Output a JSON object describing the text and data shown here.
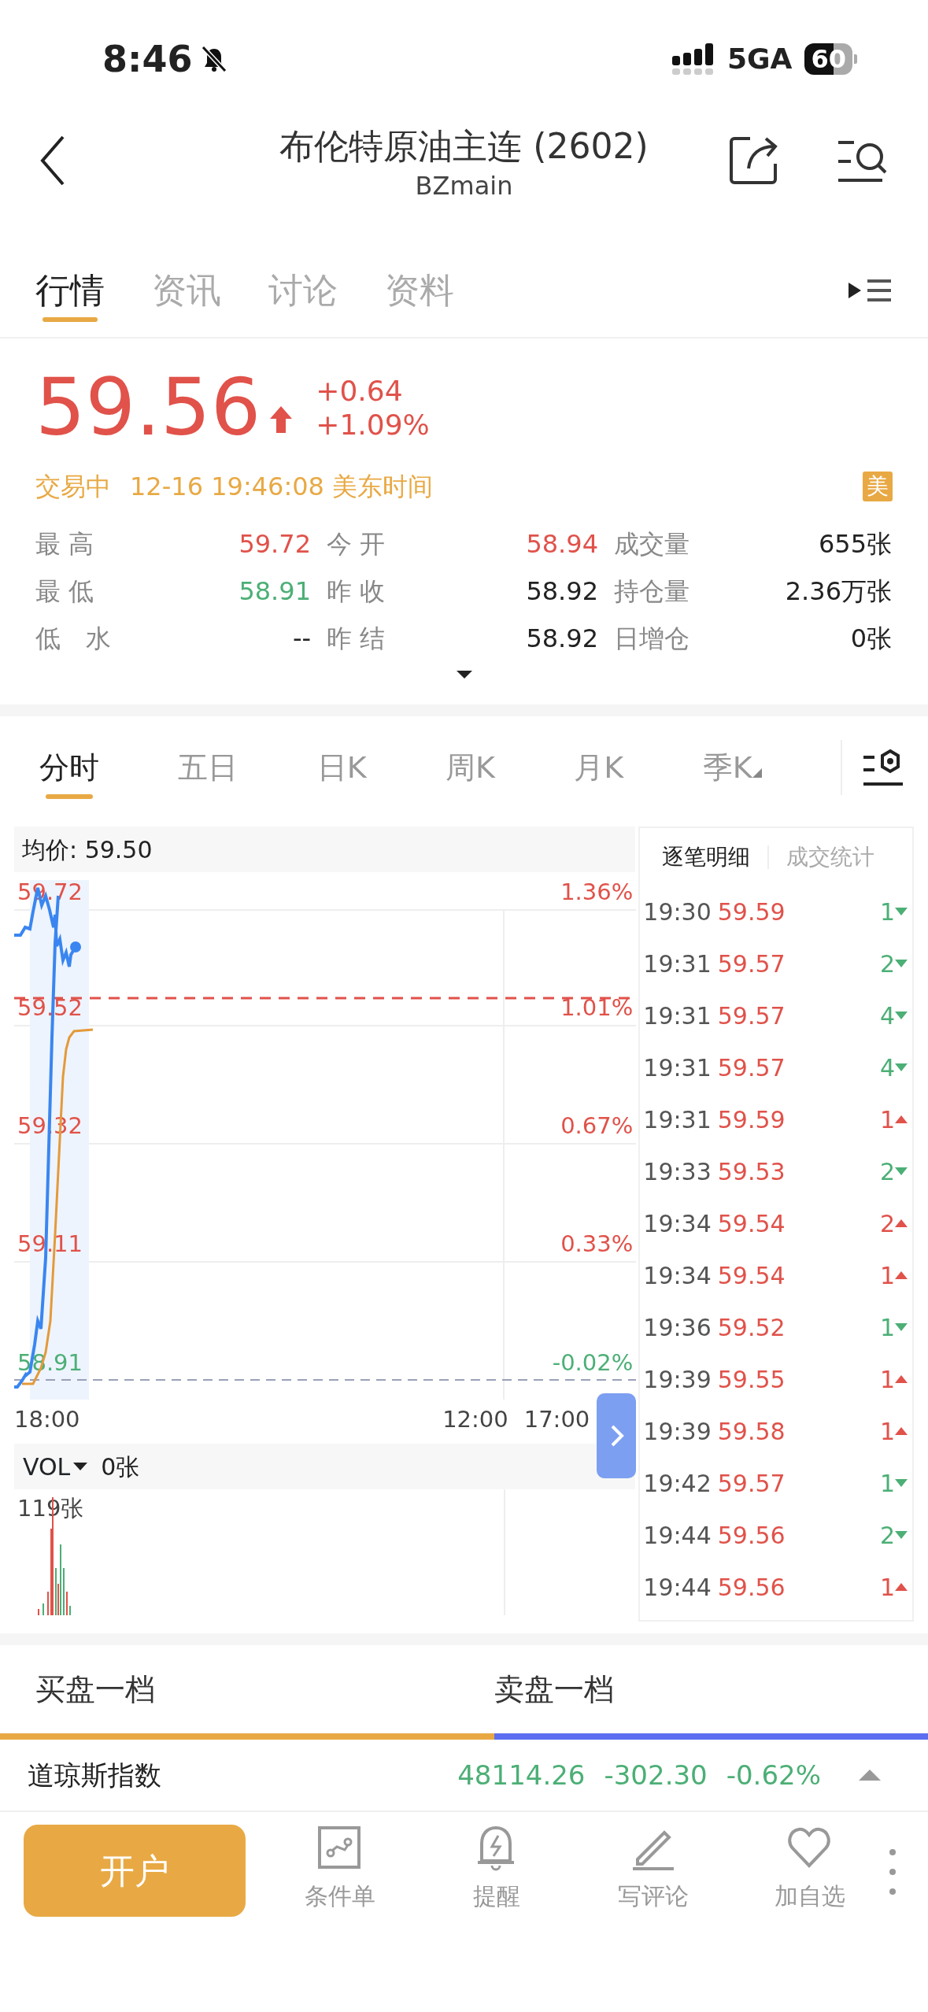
{
  "status_bar": {
    "time": "8:46",
    "network": "5GA",
    "battery": "60"
  },
  "header": {
    "title": "布伦特原油主连 (2602)",
    "subtitle": "BZmain"
  },
  "tabs": [
    {
      "label": "行情",
      "selected": true
    },
    {
      "label": "资讯",
      "selected": false
    },
    {
      "label": "讨论",
      "selected": false
    },
    {
      "label": "资料",
      "selected": false
    }
  ],
  "quote": {
    "price": "59.56",
    "up": true,
    "change": "+0.64",
    "change_pct": "+1.09%",
    "status": "交易中",
    "time": "12-16 19:46:08 美东时间",
    "market_badge": "美"
  },
  "stats": [
    {
      "items": [
        {
          "label": "最 高",
          "value": "59.72",
          "color": "#e0524a"
        },
        {
          "label": "今 开",
          "value": "58.94",
          "color": "#e0524a"
        },
        {
          "label": "成交量",
          "value": "655张",
          "color": "#222222"
        }
      ]
    },
    {
      "items": [
        {
          "label": "最 低",
          "value": "58.91",
          "color": "#4caf76"
        },
        {
          "label": "昨 收",
          "value": "58.92",
          "color": "#222222"
        },
        {
          "label": "持仓量",
          "value": "2.36万张",
          "color": "#222222"
        }
      ]
    },
    {
      "items": [
        {
          "label": "低　水",
          "value": "--",
          "color": "#222222"
        },
        {
          "label": "昨 结",
          "value": "58.92",
          "color": "#222222"
        },
        {
          "label": "日增仓",
          "value": "0张",
          "color": "#222222"
        }
      ]
    }
  ],
  "chart_tabs": [
    {
      "label": "分时",
      "selected": true,
      "dropdown": false
    },
    {
      "label": "五日",
      "selected": false,
      "dropdown": false
    },
    {
      "label": "日K",
      "selected": false,
      "dropdown": false
    },
    {
      "label": "周K",
      "selected": false,
      "dropdown": false
    },
    {
      "label": "月K",
      "selected": false,
      "dropdown": false
    },
    {
      "label": "季K",
      "selected": false,
      "dropdown": true
    }
  ],
  "chart": {
    "average": "均价: 59.50",
    "left_labels": [
      {
        "text": "59.72",
        "color": "#e0524a"
      },
      {
        "text": "59.52",
        "color": "#e0524a"
      },
      {
        "text": "59.32",
        "color": "#e0524a"
      },
      {
        "text": "59.11",
        "color": "#e0524a"
      },
      {
        "text": "58.91",
        "color": "#4caf76"
      }
    ],
    "right_labels": [
      {
        "text": "1.36%",
        "color": "#e0524a"
      },
      {
        "text": "1.01%",
        "color": "#e0524a"
      },
      {
        "text": "0.67%",
        "color": "#e0524a"
      },
      {
        "text": "0.33%",
        "color": "#e0524a"
      },
      {
        "text": "-0.02%",
        "color": "#4caf76"
      }
    ],
    "x_labels": [
      "18:00",
      "12:00",
      "17:00"
    ],
    "volume": {
      "label": "VOL",
      "value": "0张",
      "max": "119张"
    }
  },
  "trades": {
    "tabs": [
      {
        "label": "逐笔明细",
        "selected": true
      },
      {
        "label": "成交统计",
        "selected": false
      }
    ],
    "rows": [
      {
        "time": "19:30",
        "price": "59.59",
        "qty": "1",
        "up": false
      },
      {
        "time": "19:31",
        "price": "59.57",
        "qty": "2",
        "up": false
      },
      {
        "time": "19:31",
        "price": "59.57",
        "qty": "4",
        "up": false
      },
      {
        "time": "19:31",
        "price": "59.57",
        "qty": "4",
        "up": false
      },
      {
        "time": "19:31",
        "price": "59.59",
        "qty": "1",
        "up": true
      },
      {
        "time": "19:33",
        "price": "59.53",
        "qty": "2",
        "up": false
      },
      {
        "time": "19:34",
        "price": "59.54",
        "qty": "2",
        "up": true
      },
      {
        "time": "19:34",
        "price": "59.54",
        "qty": "1",
        "up": true
      },
      {
        "time": "19:36",
        "price": "59.52",
        "qty": "1",
        "up": false
      },
      {
        "time": "19:39",
        "price": "59.55",
        "qty": "1",
        "up": true
      },
      {
        "time": "19:39",
        "price": "59.58",
        "qty": "1",
        "up": true
      },
      {
        "time": "19:42",
        "price": "59.57",
        "qty": "1",
        "up": false
      },
      {
        "time": "19:44",
        "price": "59.56",
        "qty": "2",
        "up": false
      },
      {
        "time": "19:44",
        "price": "59.56",
        "qty": "1",
        "up": true
      }
    ]
  },
  "depth": {
    "bid": "买盘一档",
    "ask": "卖盘一档",
    "level": 0.533
  },
  "ticker": {
    "name": "道琼斯指数",
    "price": "48114.26",
    "change": "-302.30",
    "change_pct": "-0.62%",
    "color": "#4caf76"
  },
  "footer": {
    "primary": "开户",
    "actions": [
      {
        "label": "条件单"
      },
      {
        "label": "提醒"
      },
      {
        "label": "写评论"
      },
      {
        "label": "加自选"
      }
    ]
  }
}
